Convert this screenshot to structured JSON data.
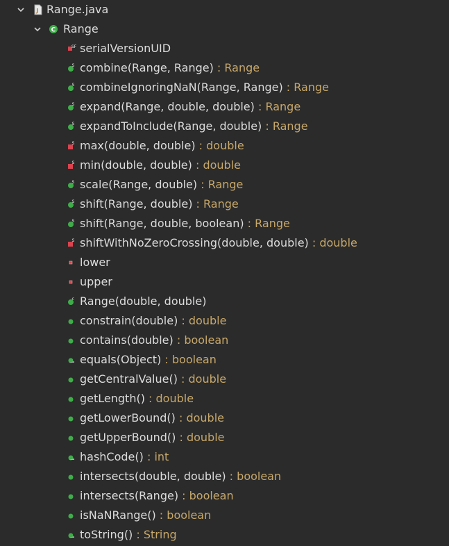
{
  "file": {
    "label": "Range.java",
    "icon": "java-file-icon"
  },
  "class": {
    "label": "Range",
    "icon": "class-icon"
  },
  "members": [
    {
      "name": "serialVersionUID",
      "type": "",
      "icon": "static-final-field-icon"
    },
    {
      "name": "combine(Range, Range)",
      "type": " : Range",
      "icon": "public-static-method-icon"
    },
    {
      "name": "combineIgnoringNaN(Range, Range)",
      "type": " : Range",
      "icon": "private-static-method-icon"
    },
    {
      "name": "expand(Range, double, double)",
      "type": " : Range",
      "icon": "public-static-method-icon"
    },
    {
      "name": "expandToInclude(Range, double)",
      "type": " : Range",
      "icon": "public-static-method-icon"
    },
    {
      "name": "max(double, double)",
      "type": " : double",
      "icon": "private-static-method-icon"
    },
    {
      "name": "min(double, double)",
      "type": " : double",
      "icon": "private-static-method-icon"
    },
    {
      "name": "scale(Range, double)",
      "type": " : Range",
      "icon": "public-static-method-icon"
    },
    {
      "name": "shift(Range, double)",
      "type": " : Range",
      "icon": "public-static-method-icon"
    },
    {
      "name": "shift(Range, double, boolean)",
      "type": " : Range",
      "icon": "public-static-method-icon"
    },
    {
      "name": "shiftWithNoZeroCrossing(double, double)",
      "type": " : double",
      "icon": "private-static-method-icon"
    },
    {
      "name": "lower",
      "type": "",
      "icon": "private-field-icon"
    },
    {
      "name": "upper",
      "type": "",
      "icon": "private-field-icon"
    },
    {
      "name": "Range(double, double)",
      "type": "",
      "icon": "constructor-icon"
    },
    {
      "name": "constrain(double)",
      "type": " : double",
      "icon": "public-method-icon"
    },
    {
      "name": "contains(double)",
      "type": " : boolean",
      "icon": "public-method-icon"
    },
    {
      "name": "equals(Object)",
      "type": " : boolean",
      "icon": "override-method-icon"
    },
    {
      "name": "getCentralValue()",
      "type": " : double",
      "icon": "public-method-icon"
    },
    {
      "name": "getLength()",
      "type": " : double",
      "icon": "public-method-icon"
    },
    {
      "name": "getLowerBound()",
      "type": " : double",
      "icon": "public-method-icon"
    },
    {
      "name": "getUpperBound()",
      "type": " : double",
      "icon": "public-method-icon"
    },
    {
      "name": "hashCode()",
      "type": " : int",
      "icon": "override-method-icon"
    },
    {
      "name": "intersects(double, double)",
      "type": " : boolean",
      "icon": "public-method-icon"
    },
    {
      "name": "intersects(Range)",
      "type": " : boolean",
      "icon": "public-method-icon"
    },
    {
      "name": "isNaNRange()",
      "type": " : boolean",
      "icon": "public-method-icon"
    },
    {
      "name": "toString()",
      "type": " : String",
      "icon": "override-method-icon"
    }
  ],
  "colors": {
    "background": "#2b2b2b",
    "text": "#dcdcdc",
    "return_type": "#c8a86a",
    "public_green": "#3fae4a",
    "private_red": "#d9444f"
  }
}
